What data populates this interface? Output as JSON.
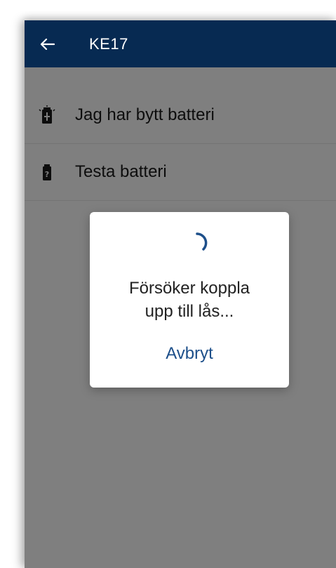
{
  "app_bar": {
    "title": "KE17",
    "back_icon": "arrow-left-icon"
  },
  "menu": {
    "items": [
      {
        "label": "Jag har bytt batteri",
        "icon": "battery-replaced-icon"
      },
      {
        "label": "Testa batteri",
        "icon": "battery-test-icon"
      }
    ]
  },
  "dialog": {
    "message_line1": "Försöker koppla",
    "message_line2": "upp till lås...",
    "cancel_label": "Avbryt",
    "spinner_icon": "loading-spinner-icon"
  },
  "colors": {
    "app_bar": "#072a52",
    "accent": "#1d4f8a",
    "scrim": "rgba(0,0,0,0.5)"
  }
}
